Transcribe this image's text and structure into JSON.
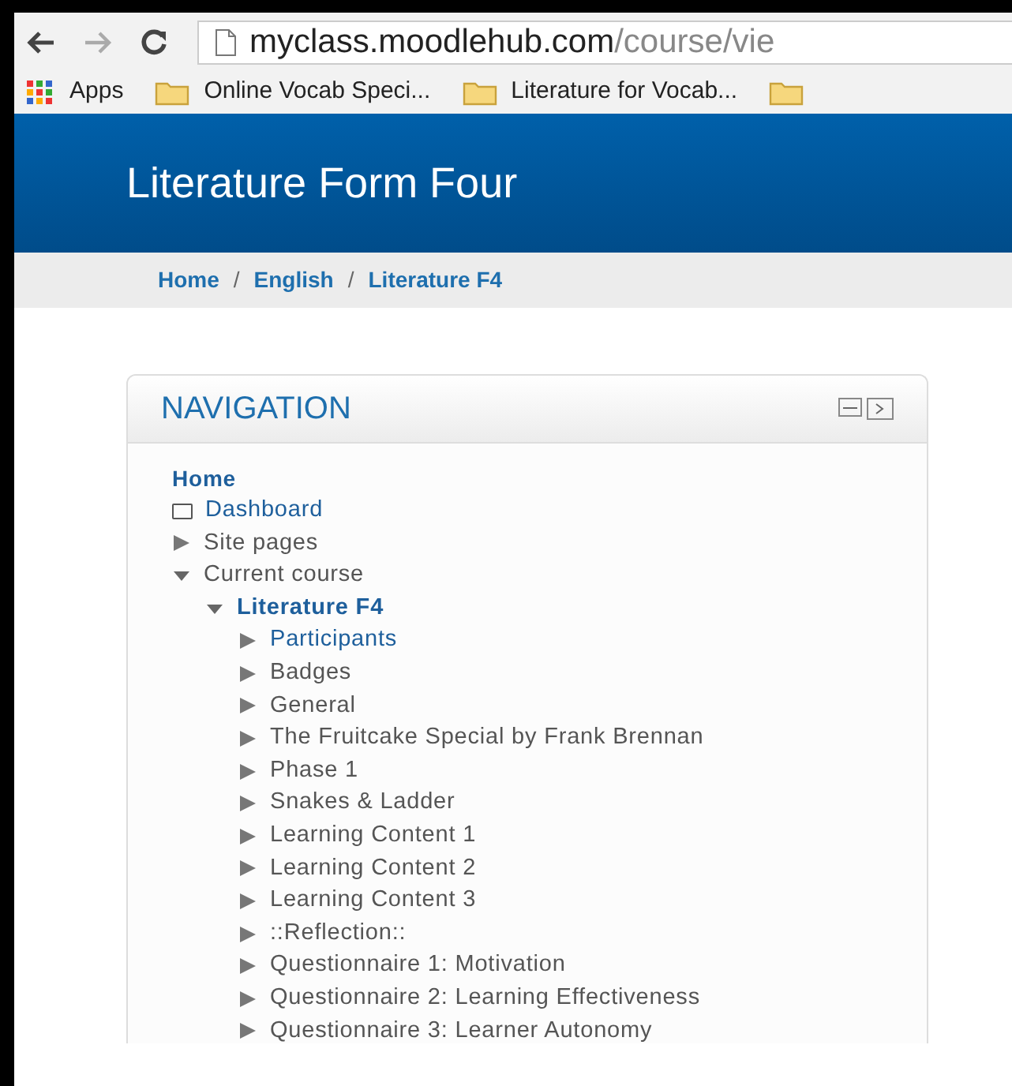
{
  "browser": {
    "url_host": "myclass.moodlehub.com",
    "url_path": "/course/vie",
    "bookmarks": [
      {
        "kind": "apps",
        "label": "Apps"
      },
      {
        "kind": "folder",
        "label": "Online Vocab Speci..."
      },
      {
        "kind": "folder",
        "label": "Literature for Vocab..."
      },
      {
        "kind": "folder"
      }
    ]
  },
  "header": {
    "title": "Literature Form Four"
  },
  "breadcrumb": [
    {
      "label": "Home"
    },
    {
      "separator": "/",
      "label": "English"
    },
    {
      "separator": "/",
      "label": "Literature F4"
    }
  ],
  "navigation": {
    "title": "NAVIGATION",
    "items": [
      {
        "kind": "home",
        "label": "Home",
        "link": true
      },
      {
        "kind": "page",
        "label": "Dashboard",
        "link": true
      },
      {
        "kind": "branch",
        "label": "Site pages",
        "link": false,
        "expanded": false
      },
      {
        "kind": "branch",
        "label": "Current course",
        "link": false,
        "expanded": true,
        "children": [
          {
            "kind": "branch",
            "label": "Literature F4",
            "link": true,
            "bold": true,
            "expanded": true,
            "children": [
              {
                "kind": "branch",
                "label": "Participants",
                "link": true,
                "expanded": false
              },
              {
                "kind": "branch",
                "label": "Badges",
                "link": false,
                "expanded": false
              },
              {
                "kind": "branch",
                "label": "General",
                "link": false,
                "expanded": false
              },
              {
                "kind": "branch",
                "label": "The Fruitcake Special by Frank Brennan",
                "link": false,
                "expanded": false
              },
              {
                "kind": "branch",
                "label": "Phase 1",
                "link": false,
                "expanded": false
              },
              {
                "kind": "branch",
                "label": "Snakes & Ladder",
                "link": false,
                "expanded": false
              },
              {
                "kind": "branch",
                "label": "Learning Content 1",
                "link": false,
                "expanded": false
              },
              {
                "kind": "branch",
                "label": "Learning Content 2",
                "link": false,
                "expanded": false
              },
              {
                "kind": "branch",
                "label": "Learning Content 3",
                "link": false,
                "expanded": false
              },
              {
                "kind": "branch",
                "label": "::Reflection::",
                "link": false,
                "expanded": false
              },
              {
                "kind": "branch",
                "label": "Questionnaire 1: Motivation",
                "link": false,
                "expanded": false
              },
              {
                "kind": "branch",
                "label": "Questionnaire 2: Learning Effectiveness",
                "link": false,
                "expanded": false
              },
              {
                "kind": "branch",
                "label": "Questionnaire 3: Learner Autonomy",
                "link": false,
                "expanded": false
              }
            ]
          }
        ]
      }
    ]
  }
}
